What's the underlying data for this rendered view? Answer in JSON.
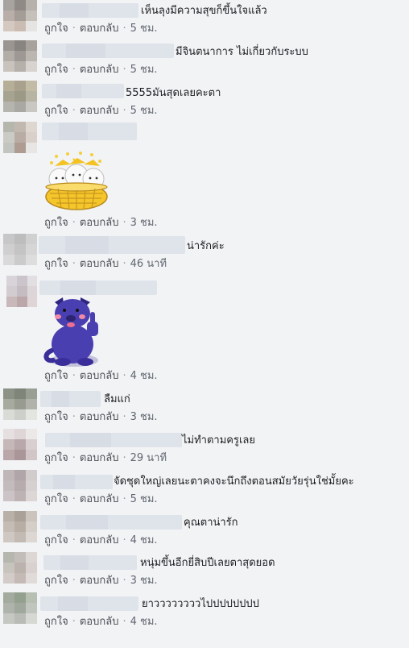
{
  "actions": {
    "like": "ถูกใจ",
    "reply": "ตอบกลับ",
    "separator": "·"
  },
  "comments": [
    {
      "text": "เห็นลุงมีความสุขก็ขึ้นใจแล้ว",
      "time": "5 ชม."
    },
    {
      "text": "มีจินตนาการ ไม่เกี่ยวกับระบบ",
      "time": "5 ชม."
    },
    {
      "text": "5555มันสุดเลยคะตา",
      "time": "5 ชม."
    },
    {
      "text": "",
      "time": "3 ชม.",
      "sticker": "cats-in-basket-sticker"
    },
    {
      "text": "น่ารักค่ะ",
      "time": "46 นาที"
    },
    {
      "text": "",
      "time": "4 ชม.",
      "sticker": "blue-dog-thumbs-up-sticker"
    },
    {
      "text": "ลืมแก่",
      "time": "3 ชม."
    },
    {
      "text": "ไม่ทำตามครูเลย",
      "time": "29 นาที"
    },
    {
      "text": "จัดชุดใหญ่เลยนะตาคงจะนึกถึงตอนสมัยวัยรุ่นใช่มั้ยคะ",
      "time": "5 ชม."
    },
    {
      "text": "คุณตาน่ารัก",
      "time": "4 ชม."
    },
    {
      "text": "หนุ่มขึ้นอีกยี่สิบปีเลยตาสุดยอด",
      "time": "3 ชม."
    },
    {
      "text": "ยาววววววววไปปปปปปปป",
      "time": "4 ชม."
    }
  ]
}
